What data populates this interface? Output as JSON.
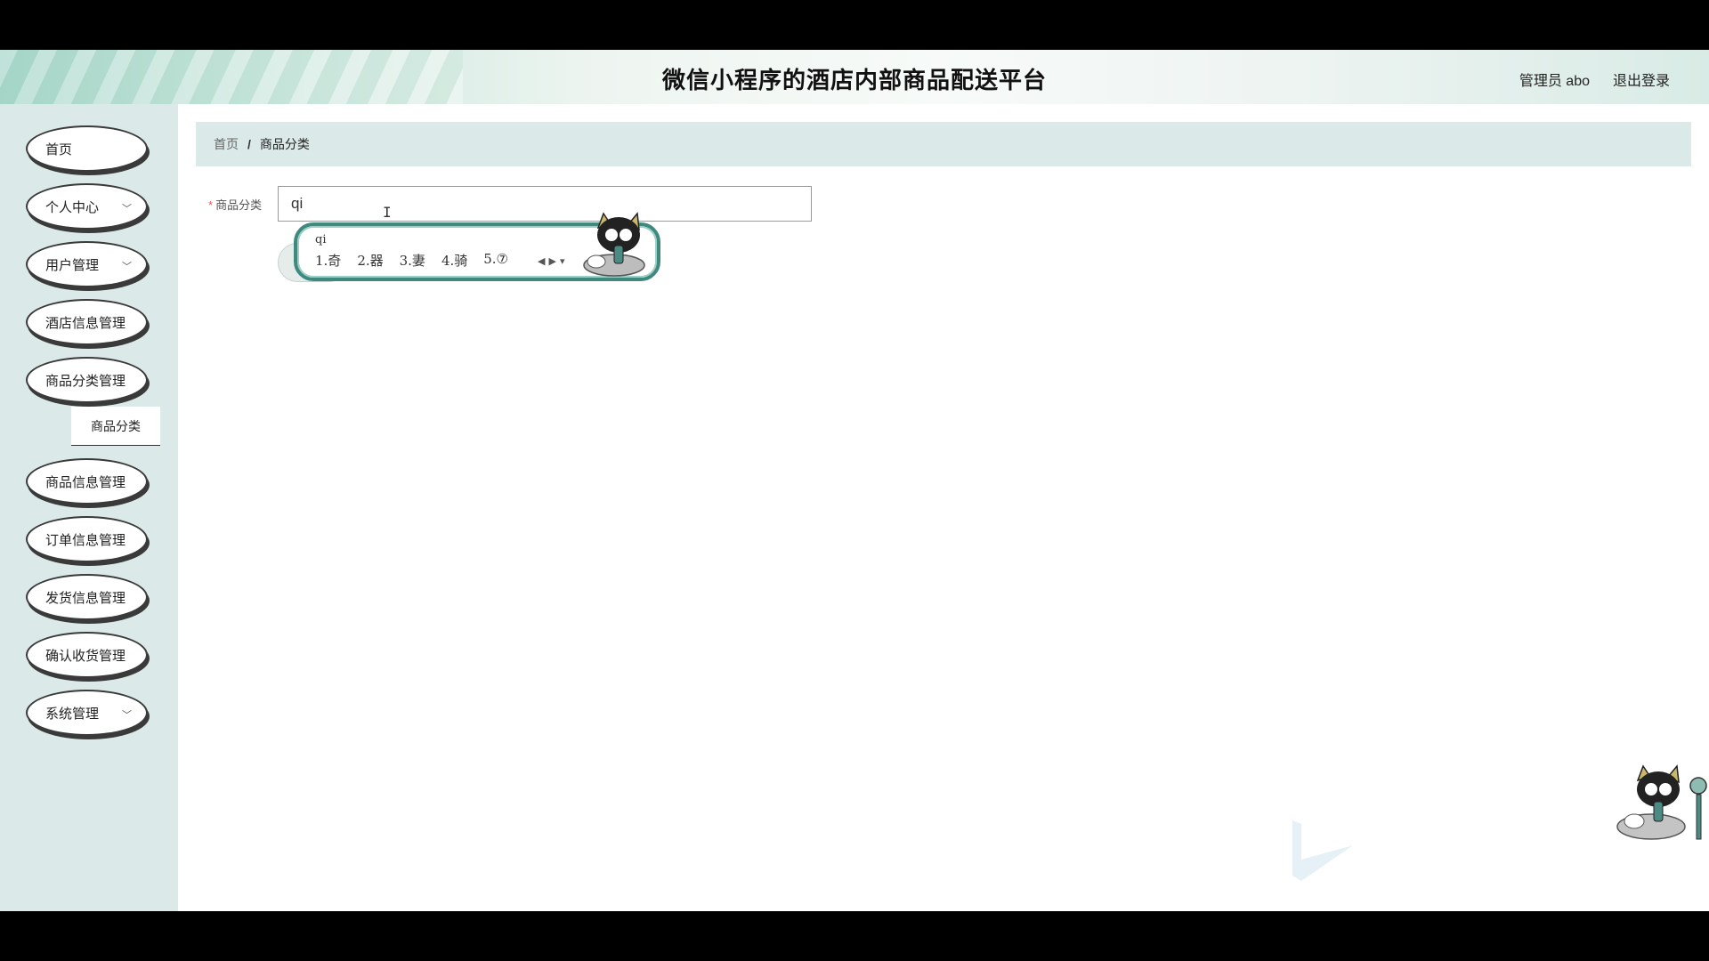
{
  "header": {
    "title": "微信小程序的酒店内部商品配送平台",
    "user": "管理员 abo",
    "logout": "退出登录"
  },
  "sidebar": {
    "items": [
      {
        "label": "首页",
        "has_arrow": false
      },
      {
        "label": "个人中心",
        "has_arrow": true
      },
      {
        "label": "用户管理",
        "has_arrow": true
      },
      {
        "label": "酒店信息管理",
        "has_arrow": false
      },
      {
        "label": "商品分类管理",
        "has_arrow": false
      },
      {
        "label": "商品信息管理",
        "has_arrow": false
      },
      {
        "label": "订单信息管理",
        "has_arrow": false
      },
      {
        "label": "发货信息管理",
        "has_arrow": false
      },
      {
        "label": "确认收货管理",
        "has_arrow": false
      },
      {
        "label": "系统管理",
        "has_arrow": true
      }
    ],
    "submenu": {
      "label": "商品分类"
    }
  },
  "breadcrumb": {
    "home": "首页",
    "separator": "/",
    "current": "商品分类"
  },
  "form": {
    "label": "商品分类",
    "required_mark": "*",
    "value": "qi"
  },
  "ime": {
    "pinyin": "qi",
    "candidates": [
      "1.奇",
      "2.器",
      "3.妻",
      "4.骑",
      "5.⑦"
    ]
  },
  "colors": {
    "sidebar_bg": "#dbeae8",
    "breadcrumb_bg": "#dbeae8",
    "ime_border": "#3e8a7f",
    "required": "#e15a5a"
  }
}
